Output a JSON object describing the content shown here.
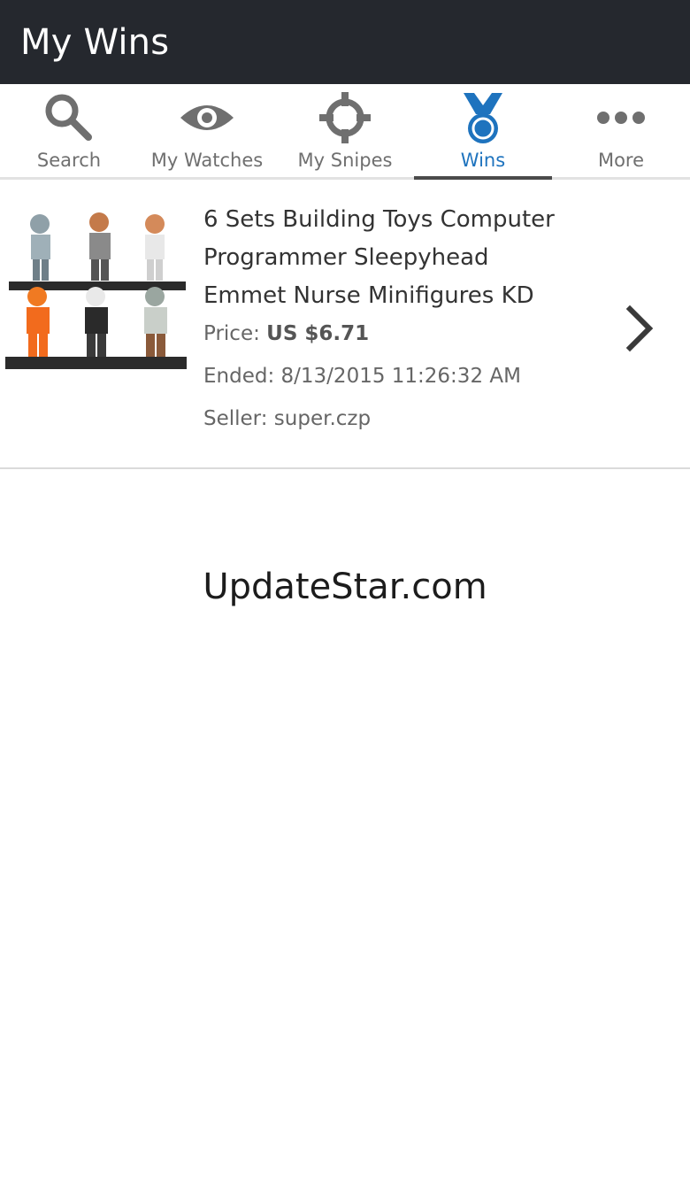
{
  "appbar": {
    "title": "My Wins"
  },
  "tabs": [
    {
      "label": "Search",
      "icon": "search-icon",
      "active": false
    },
    {
      "label": "My Watches",
      "icon": "eye-icon",
      "active": false
    },
    {
      "label": "My Snipes",
      "icon": "crosshair-icon",
      "active": false
    },
    {
      "label": "Wins",
      "icon": "medal-icon",
      "active": true
    },
    {
      "label": "More",
      "icon": "more-dots-icon",
      "active": false
    }
  ],
  "listing": {
    "title_lines": [
      "6 Sets Building Toys Computer",
      "Programmer Sleepyhead",
      "Emmet Nurse Minifigures KD"
    ],
    "price_label": "Price:",
    "price_value": "US $6.71",
    "ended_label": "Ended:",
    "ended_value": "8/13/2015 11:26:32 AM",
    "seller_label": "Seller:",
    "seller_value": "super.czp"
  },
  "watermark": "UpdateStar.com",
  "colors": {
    "appbar_bg": "#25282e",
    "active_tab": "#1e73be",
    "inactive_tab": "#6f6f6f",
    "indicator": "#4b4b4b"
  }
}
